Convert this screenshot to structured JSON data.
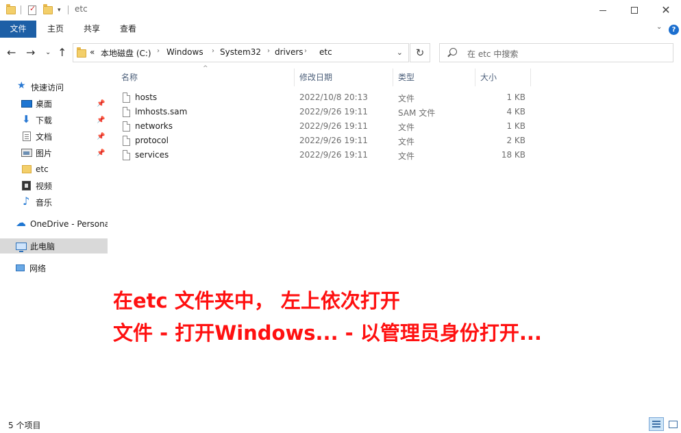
{
  "window": {
    "title": "etc"
  },
  "ribbon": {
    "tabs": [
      {
        "label": "文件",
        "active": true
      },
      {
        "label": "主页",
        "active": false
      },
      {
        "label": "共享",
        "active": false
      },
      {
        "label": "查看",
        "active": false
      }
    ]
  },
  "address": {
    "overflow": "«",
    "crumbs": [
      "本地磁盘 (C:)",
      "Windows",
      "System32",
      "drivers",
      "etc"
    ],
    "separator": "›"
  },
  "search": {
    "placeholder": "在 etc 中搜索"
  },
  "sidebar": {
    "items": [
      {
        "label": "快速访问",
        "icon": "star-icon",
        "pinned": false
      },
      {
        "label": "桌面",
        "icon": "desktop-icon",
        "pinned": true
      },
      {
        "label": "下载",
        "icon": "download-icon",
        "pinned": true
      },
      {
        "label": "文档",
        "icon": "document-icon",
        "pinned": true
      },
      {
        "label": "图片",
        "icon": "pictures-icon",
        "pinned": true
      },
      {
        "label": "etc",
        "icon": "folder-icon",
        "pinned": false
      },
      {
        "label": "视频",
        "icon": "video-icon",
        "pinned": false
      },
      {
        "label": "音乐",
        "icon": "music-icon",
        "pinned": false
      },
      {
        "label": "OneDrive - Persona",
        "icon": "onedrive-icon",
        "pinned": false
      },
      {
        "label": "此电脑",
        "icon": "this-pc-icon",
        "pinned": false,
        "selected": true
      },
      {
        "label": "网络",
        "icon": "network-icon",
        "pinned": false
      }
    ]
  },
  "columns": {
    "name": "名称",
    "date": "修改日期",
    "type": "类型",
    "size": "大小"
  },
  "files": [
    {
      "name": "hosts",
      "date": "2022/10/8 20:13",
      "type": "文件",
      "size": "1 KB"
    },
    {
      "name": "lmhosts.sam",
      "date": "2022/9/26 19:11",
      "type": "SAM 文件",
      "size": "4 KB"
    },
    {
      "name": "networks",
      "date": "2022/9/26 19:11",
      "type": "文件",
      "size": "1 KB"
    },
    {
      "name": "protocol",
      "date": "2022/9/26 19:11",
      "type": "文件",
      "size": "2 KB"
    },
    {
      "name": "services",
      "date": "2022/9/26 19:11",
      "type": "文件",
      "size": "18 KB"
    }
  ],
  "annotation": {
    "line1": "在etc 文件夹中， 左上依次打开",
    "line2": "文件 - 打开Windows... - 以管理员身份打开..."
  },
  "status": {
    "item_count": "5 个项目"
  },
  "colors": {
    "accent": "#1d5fa6",
    "annotation": "#ff1010",
    "selected_bg": "#d9d9d9"
  }
}
